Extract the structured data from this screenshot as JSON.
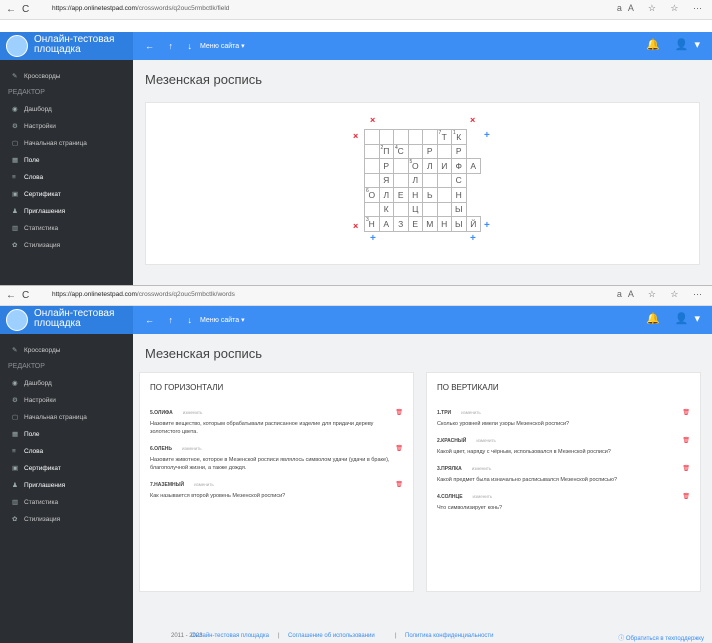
{
  "shot1": {
    "url_host": "https://app.onlinetestpad.com",
    "url_path": "/crosswords/q2ouc5rmbctlk/field",
    "nav_back": "←",
    "nav_reload": "C",
    "browser_icons": "aA ☆ ☆ ⋯"
  },
  "shot2": {
    "url_host": "https://app.onlinetestpad.com",
    "url_path": "/crosswords/q2ouc5rmbctlk/words",
    "nav_back": "←",
    "nav_reload": "C",
    "browser_icons": "aA ☆ ☆ ⋯"
  },
  "topbar": {
    "logo_line1": "Онлайн-тестовая",
    "logo_line2": "площадка",
    "arrows": "← ↑ ↓",
    "menu": "Меню сайта ▾",
    "right_icons": "🔔 👤▾"
  },
  "sidebar": {
    "crosswords": "Кроссворды",
    "section": "РЕДАКТОР",
    "items": [
      {
        "label": "Дашборд",
        "icon": "◉"
      },
      {
        "label": "Настройки",
        "icon": "⚙"
      },
      {
        "label": "Начальная страница",
        "icon": "▢"
      },
      {
        "label": "Поле",
        "icon": "▦"
      },
      {
        "label": "Слова",
        "icon": "≡"
      },
      {
        "label": "Сертификат",
        "icon": "▣"
      },
      {
        "label": "Приглашения",
        "icon": "♟"
      },
      {
        "label": "Статистика",
        "icon": "▥"
      },
      {
        "label": "Стилизация",
        "icon": "✿"
      }
    ]
  },
  "page_title": "Мезенская роспись",
  "grid": {
    "rows": [
      [
        "",
        "",
        "",
        "",
        "",
        "7|Т",
        "1|К"
      ],
      [
        "",
        "2|П",
        "4|С",
        "",
        "Р",
        "",
        "Р"
      ],
      [
        "",
        "Р",
        "",
        "5|О",
        "Л",
        "И",
        "Ф",
        "А"
      ],
      [
        "",
        "Я",
        "",
        "Л",
        "",
        "",
        "С"
      ],
      [
        "6|О",
        "Л",
        "Е",
        "Н",
        "Ь",
        "",
        "Н"
      ],
      [
        "",
        "К",
        "",
        "Ц",
        "",
        "",
        "Ы"
      ],
      [
        "3|Н",
        "А",
        "З",
        "Е",
        "М",
        "Н",
        "Ы",
        "Й"
      ]
    ],
    "x_mark": "×",
    "plus_mark": "+"
  },
  "words": {
    "horizontal_title": "ПО ГОРИЗОНТАЛИ",
    "vertical_title": "ПО ВЕРТИКАЛИ",
    "edit_label": "изменить",
    "delete_icon": "trash-icon",
    "horizontal": [
      {
        "word": "5.ОЛИФА",
        "question": "Назовите вещество, которым обрабатывали расписанное изделие для придачи дереву золотистого цвета."
      },
      {
        "word": "6.ОЛЕНЬ",
        "question": "Назовите животное, которое в Мезенской росписи являлось символом удачи (удачи в браке), благополучной жизни, а также дождя."
      },
      {
        "word": "7.НАЗЕМНЫЙ",
        "question": "Как называется второй уровень Мезенской росписи?"
      }
    ],
    "vertical": [
      {
        "word": "1.ТРИ",
        "question": "Сколько уровней имели узоры Мезенской росписи?"
      },
      {
        "word": "2.КРАСНЫЙ",
        "question": "Какой цвет, наряду с чёрным, использовался в Мезенской росписи?"
      },
      {
        "word": "3.ПРЯЛКА",
        "question": "Какой предмет была изначально расписывался Мезенской росписью?"
      },
      {
        "word": "4.СОЛНЦЕ",
        "question": "Что символизирует конь?"
      }
    ]
  },
  "footer": {
    "copyright": "2011 - 2023",
    "site": "Онлайн-тестовая площадка",
    "terms": "Соглашение об использовании",
    "privacy": "Политика конфиденциальности",
    "support": "Обратиться в техподдержку"
  }
}
